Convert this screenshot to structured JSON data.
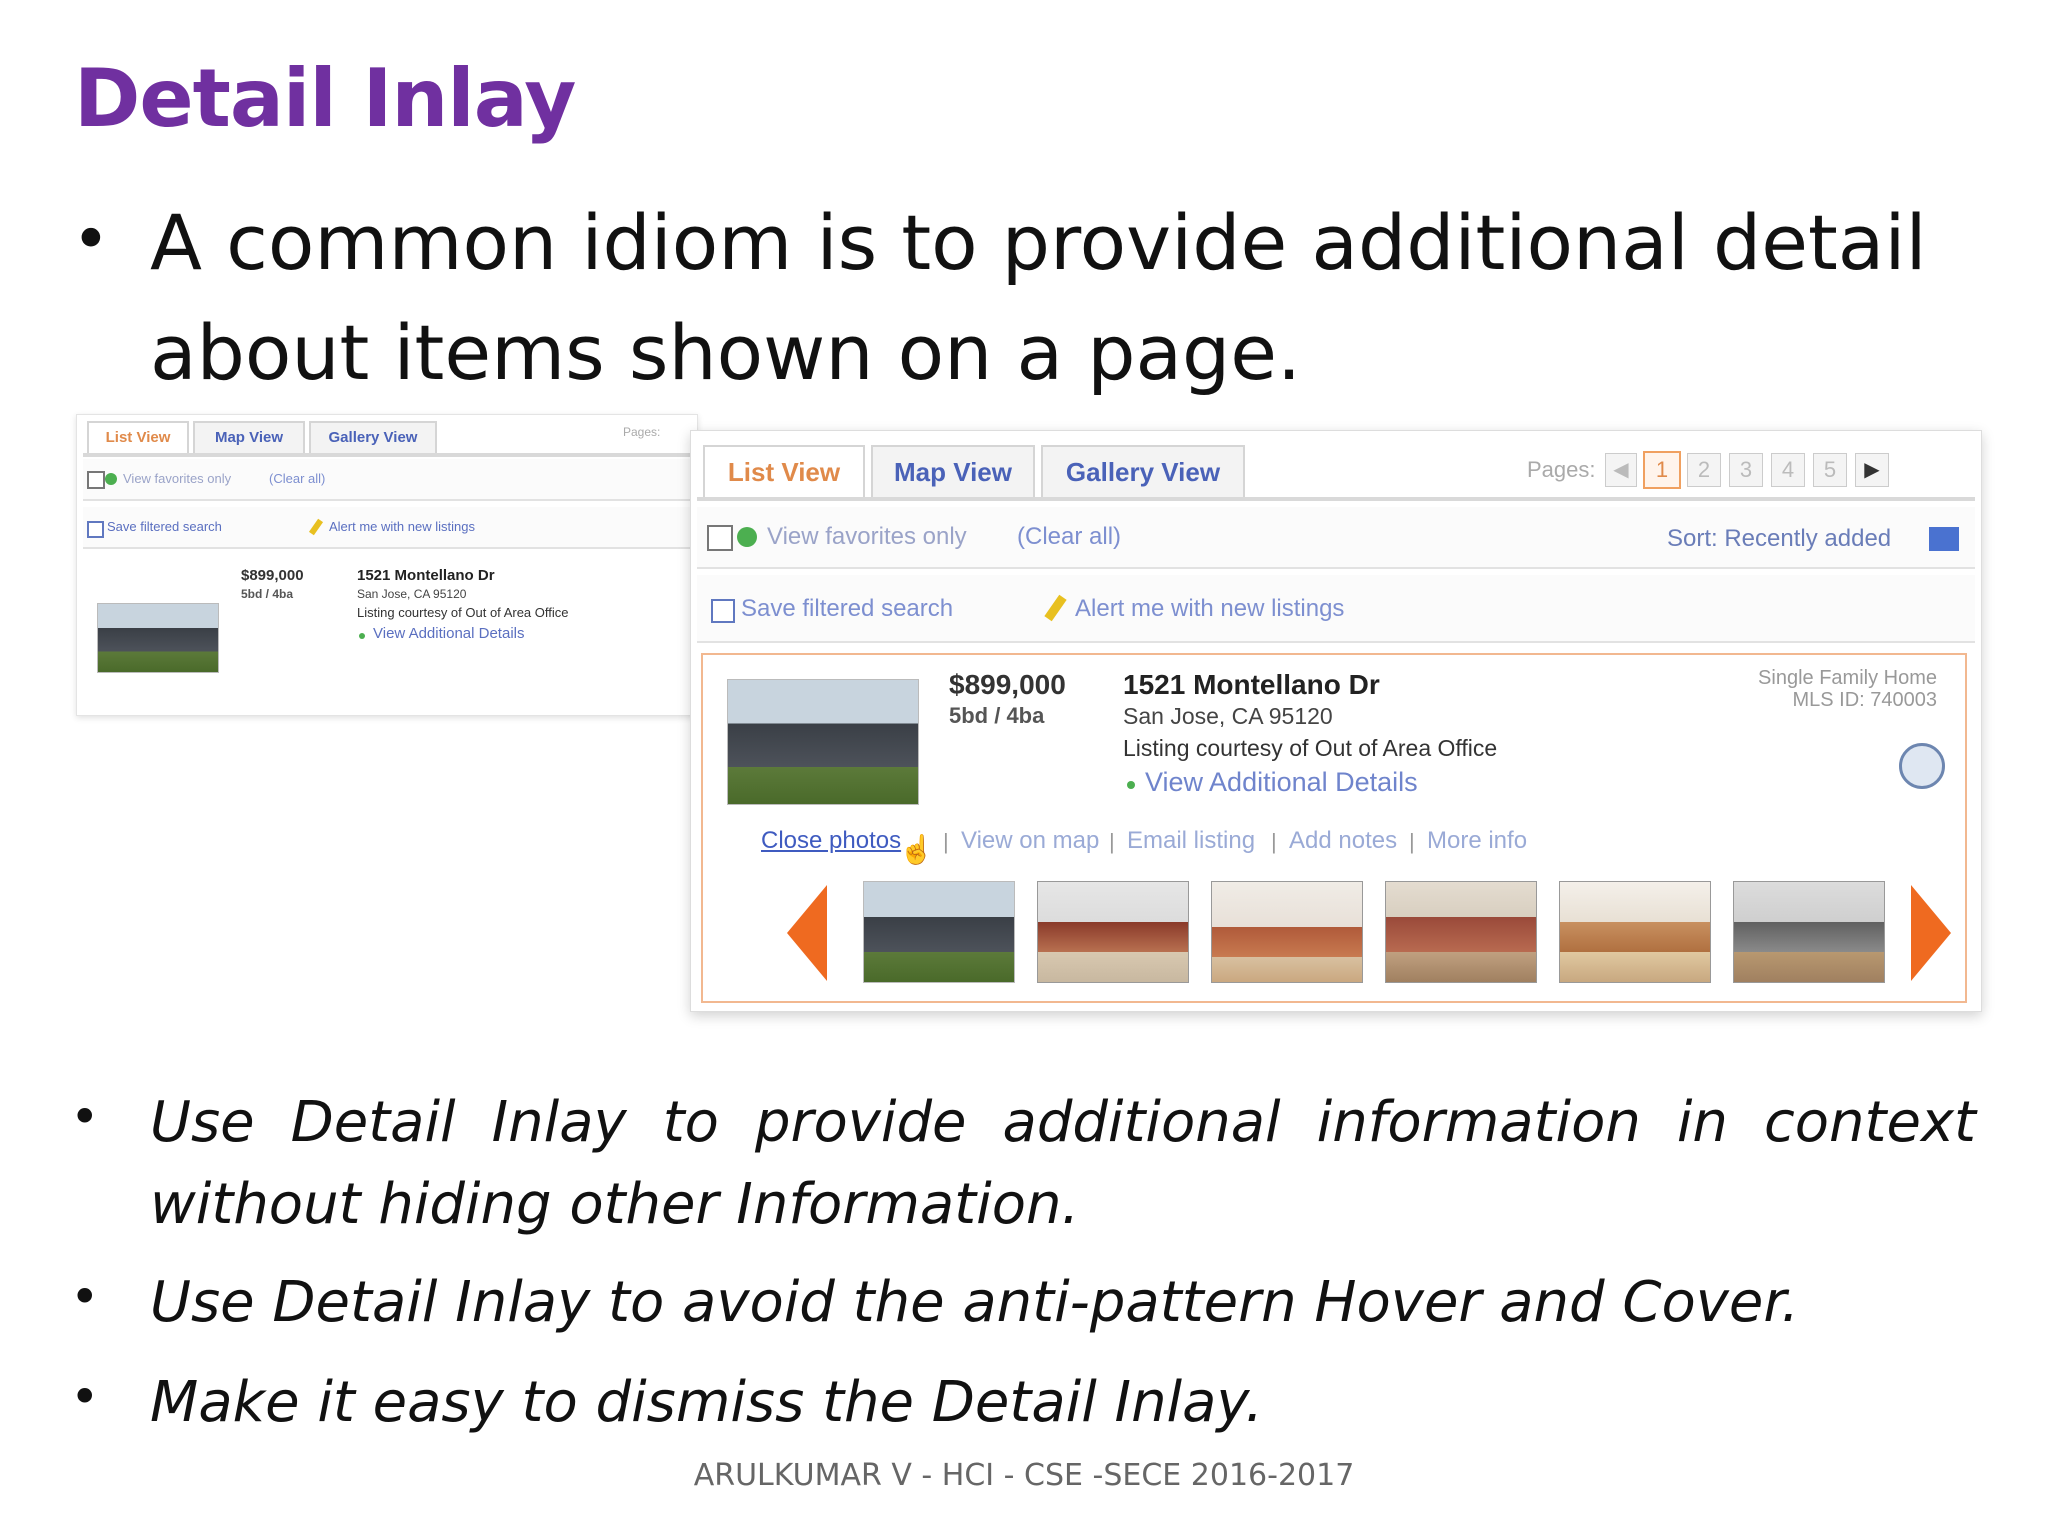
{
  "slide": {
    "title": "Detail Inlay",
    "bullet_char": "•",
    "main_bullet": "A common idiom is to provide additional detail about items shown on a page.",
    "bullets": [
      "Use Detail Inlay to provide additional information in context without hiding other Information.",
      "Use Detail Inlay to avoid the anti-pattern Hover and Cover.",
      "Make it easy to dismiss the Detail Inlay."
    ],
    "footer": "ARULKUMAR V - HCI - CSE -SECE 2016-2017",
    "title_color": "#7030a0"
  },
  "listing_ui": {
    "tabs": [
      "List View",
      "Map View",
      "Gallery View"
    ],
    "pages_label": "Pages:",
    "pages": [
      "1",
      "2",
      "3",
      "4",
      "5"
    ],
    "favorites_label": "View favorites only",
    "clear_all": "(Clear all)",
    "sort_label": "Sort: Recently added",
    "save_search": "Save filtered search",
    "alert": "Alert me with new listings",
    "price": "$899,000",
    "beds_baths": "5bd / 4ba",
    "address": "1521 Montellano Dr",
    "city": "San Jose, CA 95120",
    "courtesy": "Listing courtesy of Out of Area Office",
    "view_details": "View Additional Details",
    "home_type": "Single Family Home",
    "mls": "MLS ID: 740003",
    "actions": [
      "Close photos",
      "View on map",
      "Email listing",
      "Add notes",
      "More info"
    ],
    "accent_color": "#ef6a20",
    "link_color": "#5a6fc0"
  }
}
